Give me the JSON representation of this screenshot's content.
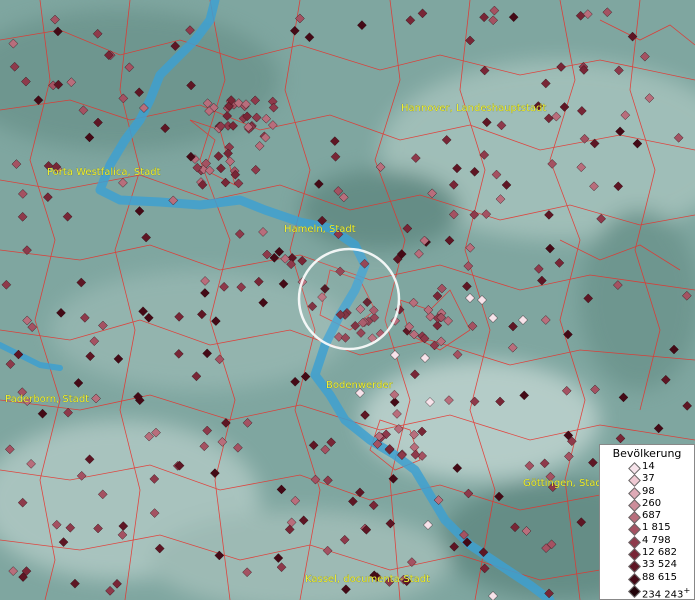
{
  "map": {
    "colors": {
      "background_hills": "#6f9890",
      "background_plain": "#a9c6c0",
      "river": "#3ea0d0",
      "borders": "#e8302a",
      "label": "#f2f230",
      "focus_circle": "#ffffff"
    },
    "cities": [
      {
        "name": "Hannover, Landeshauptstadt"
      },
      {
        "name": "Porta Westfalica, Stadt"
      },
      {
        "name": "Hameln, Stadt"
      },
      {
        "name": "Bodenwerder"
      },
      {
        "name": "Paderborn, Stadt"
      },
      {
        "name": "Göttingen, Stadt"
      },
      {
        "name": "Kassel, documenta-Stadt"
      }
    ],
    "legend": {
      "title": "Bevölkerung",
      "classes": [
        {
          "label": "14",
          "color": "#f6e3ea"
        },
        {
          "label": "37",
          "color": "#eec9d2"
        },
        {
          "label": "98",
          "color": "#deaab6"
        },
        {
          "label": "260",
          "color": "#cc8d9a"
        },
        {
          "label": "687",
          "color": "#b86e7c"
        },
        {
          "label": "1 815",
          "color": "#a45262"
        },
        {
          "label": "4 798",
          "color": "#8e3a4b"
        },
        {
          "label": "12 682",
          "color": "#782636"
        },
        {
          "label": "33 524",
          "color": "#5e1624"
        },
        {
          "label": "88 615",
          "color": "#440a16"
        },
        {
          "label": "234 243",
          "color": "#22030a"
        }
      ],
      "overflow_mark": "+"
    }
  }
}
